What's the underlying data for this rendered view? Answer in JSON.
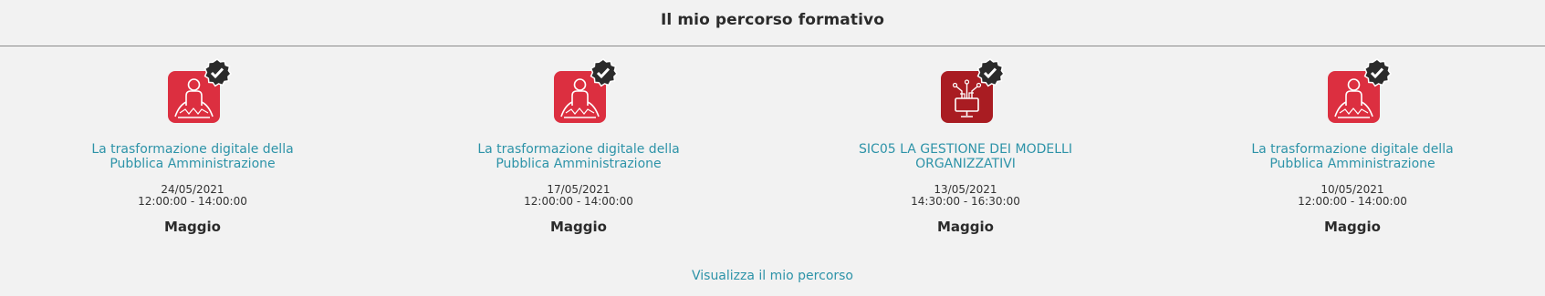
{
  "header": {
    "title": "Il mio percorso formativo"
  },
  "courses": [
    {
      "icon": "person-course-icon",
      "completed_icon": "check-badge-icon",
      "title": "La trasformazione digitale della Pubblica Amministrazione",
      "date": "24/05/2021",
      "time": "12:00:00 - 14:00:00",
      "month": "Maggio"
    },
    {
      "icon": "person-course-icon",
      "completed_icon": "check-badge-icon",
      "title": "La trasformazione digitale della Pubblica Amministrazione",
      "date": "17/05/2021",
      "time": "12:00:00 - 14:00:00",
      "month": "Maggio"
    },
    {
      "icon": "digital-network-icon",
      "completed_icon": "check-badge-icon",
      "title": "SIC05 LA GESTIONE DEI MODELLI ORGANIZZATIVI",
      "date": "13/05/2021",
      "time": "14:30:00 - 16:30:00",
      "month": "Maggio"
    },
    {
      "icon": "person-course-icon",
      "completed_icon": "check-badge-icon",
      "title": "La trasformazione digitale della Pubblica Amministrazione",
      "date": "10/05/2021",
      "time": "12:00:00 - 14:00:00",
      "month": "Maggio"
    }
  ],
  "footer": {
    "link_label": "Visualizza il mio percorso"
  },
  "colors": {
    "background": "#f2f2f2",
    "link": "#2d93a8",
    "icon_red": "#dc2f40",
    "icon_dark_red": "#a91c22",
    "badge": "#2b2b2b"
  }
}
